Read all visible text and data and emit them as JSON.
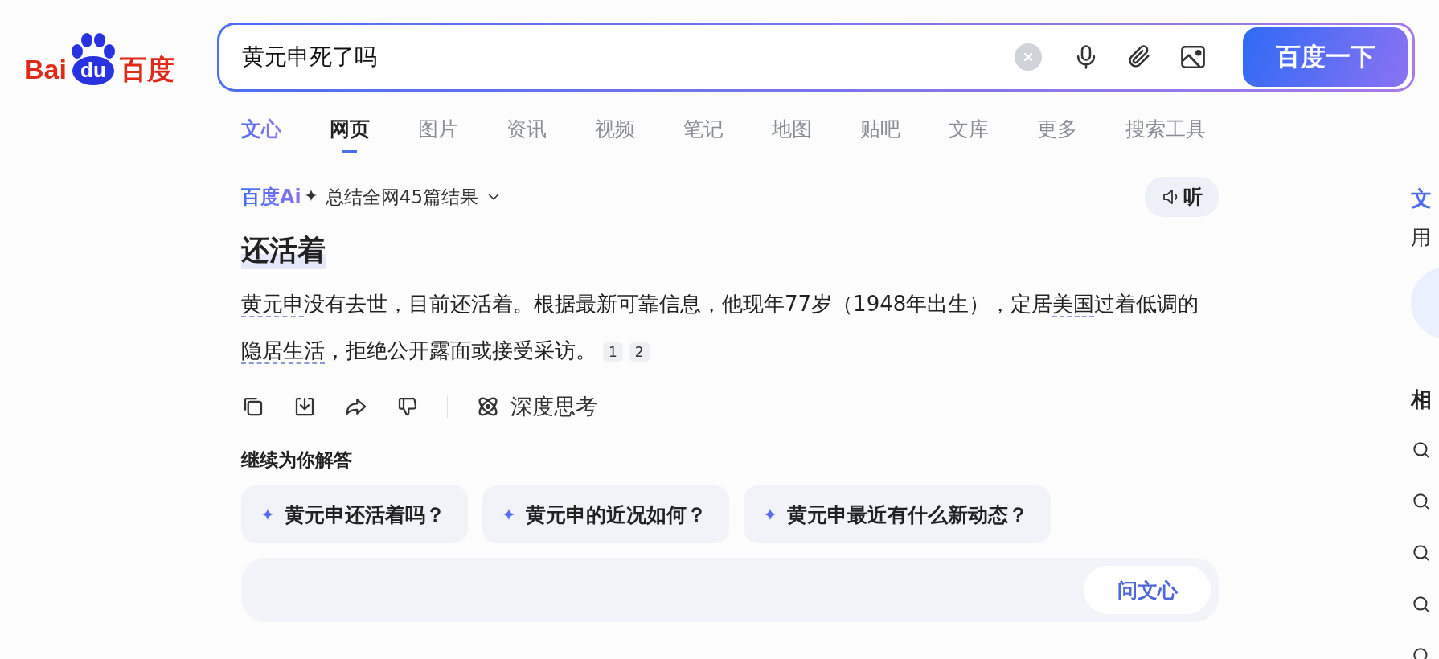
{
  "logo": {
    "parts": [
      "Bai",
      "du",
      "百度"
    ]
  },
  "search": {
    "value": "黄元申死了吗",
    "button": "百度一下"
  },
  "tabs": [
    {
      "label": "文心",
      "kind": "ai",
      "selected": false
    },
    {
      "label": "网页",
      "kind": "normal",
      "selected": true
    },
    {
      "label": "图片",
      "kind": "normal",
      "selected": false
    },
    {
      "label": "资讯",
      "kind": "normal",
      "selected": false
    },
    {
      "label": "视频",
      "kind": "normal",
      "selected": false
    },
    {
      "label": "笔记",
      "kind": "normal",
      "selected": false
    },
    {
      "label": "地图",
      "kind": "normal",
      "selected": false
    },
    {
      "label": "贴吧",
      "kind": "normal",
      "selected": false
    },
    {
      "label": "文库",
      "kind": "normal",
      "selected": false
    },
    {
      "label": "更多",
      "kind": "normal",
      "selected": false
    },
    {
      "label": "搜索工具",
      "kind": "normal",
      "selected": false
    }
  ],
  "ai_answer": {
    "brand": "百度Ai",
    "summary": "总结全网45篇结果",
    "listen": "听",
    "heading": "还活着",
    "paragraph": [
      {
        "text": "黄元申",
        "dotted": true
      },
      {
        "text": "没有去世，目前还活着。根据最新可靠信息，他现年77岁（1948年出生），定居",
        "dotted": false
      },
      {
        "text": "美国",
        "dotted": true
      },
      {
        "text": "过着低调的",
        "dotted": false
      },
      {
        "text": "隐居生活",
        "dotted": true
      },
      {
        "text": "，拒绝公开露面或接受采访。",
        "dotted": false
      }
    ],
    "citations": [
      "1",
      "2"
    ],
    "deep_think": "深度思考",
    "follow_title": "继续为你解答",
    "follow_ups": [
      "黄元申还活着吗？",
      "黄元申的近况如何？",
      "黄元申最近有什么新动态？"
    ],
    "ask_button": "问文心"
  },
  "sidebar": {
    "title": "文",
    "subtitle": "用",
    "section": "相"
  }
}
